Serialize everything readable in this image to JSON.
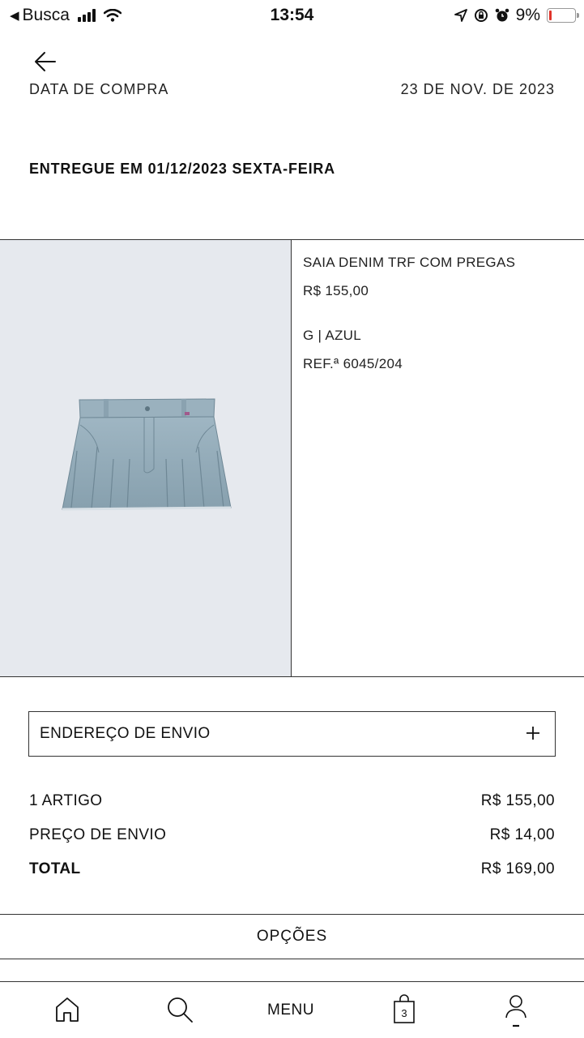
{
  "status_bar": {
    "back_app": "Busca",
    "time": "13:54",
    "battery": "9%",
    "battery_level": 0.09
  },
  "order": {
    "purchase_date_label": "DATA DE COMPRA",
    "purchase_date_value": "23 DE NOV. DE 2023",
    "delivered_text": "ENTREGUE EM 01/12/2023 SEXTA-FEIRA"
  },
  "product": {
    "name": "SAIA DENIM TRF COM PREGAS",
    "price": "R$ 155,00",
    "variant": "G | AZUL",
    "ref": "REF.ª 6045/204",
    "image_icon": "denim-skirt-image"
  },
  "address": {
    "label": "ENDEREÇO DE ENVIO"
  },
  "summary": {
    "items_label": "1 ARTIGO",
    "items_value": "R$ 155,00",
    "shipping_label": "PREÇO DE ENVIO",
    "shipping_value": "R$ 14,00",
    "total_label": "TOTAL",
    "total_value": "R$ 169,00"
  },
  "options_label": "OPÇÕES",
  "bottom_nav": {
    "menu_label": "MENU",
    "bag_count": "3"
  },
  "colors": {
    "text": "#111111",
    "image_bg": "#e6e9ee",
    "denim": "#8fa8b6",
    "battery_low": "#e0342a"
  }
}
